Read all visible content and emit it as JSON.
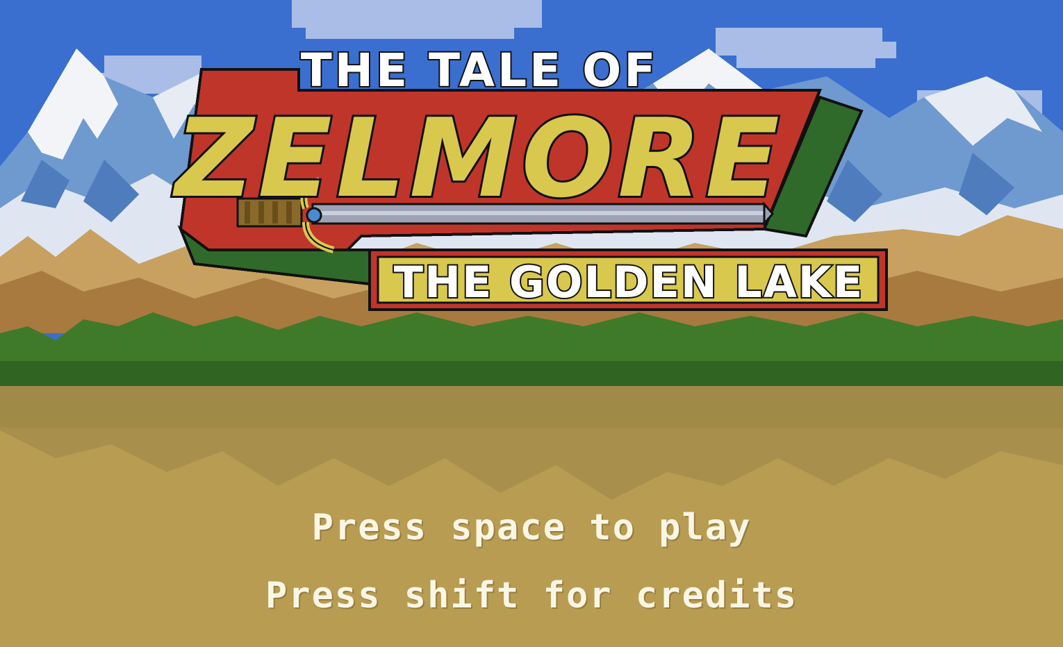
{
  "title": {
    "pre_title": "THE TALE OF",
    "main_title": "ZELMORE",
    "subtitle": "THE GOLDEN LAKE"
  },
  "prompts": {
    "play": "Press space to play",
    "credits": "Press shift for credits"
  },
  "colors": {
    "sky": "#3a6fd0",
    "cloud": "#a9bde6",
    "snow": "#f2f4f8",
    "mountain_blue": "#5c88c4",
    "hills_brown": "#b4864a",
    "forest_green": "#3f7a2a",
    "lake_gold": "#b89c52",
    "banner_red": "#c0352a",
    "banner_green": "#2f6a2a",
    "title_yellow": "#d9c84e",
    "prompt_text": "#fbf6e4"
  }
}
